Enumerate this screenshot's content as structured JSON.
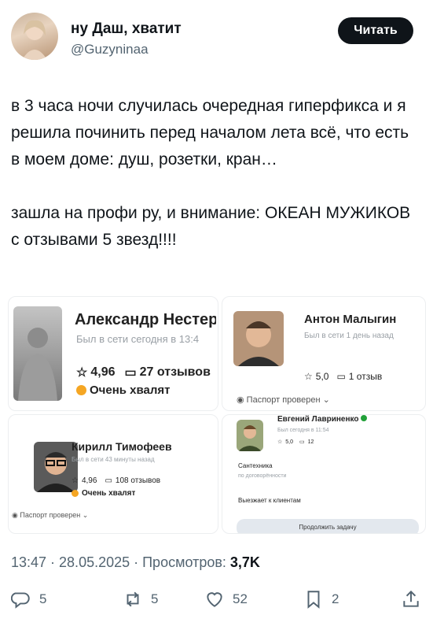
{
  "tweet": {
    "display_name": "ну Даш, хватит",
    "handle": "@Guzyninaa",
    "follow_label": "Читать",
    "text": "в 3 часа ночи случилась очередная гиперфикса и я решила починить перед началом лета всё, что есть в моем доме: душ, розетки, кран…\n\nзашла на профи ру, и внимание: ОКЕАН МУЖИКОВ с отзывами 5 звезд!!!!"
  },
  "collage": {
    "card1": {
      "name": "Александр Нестеров",
      "status": "Был в сети сегодня в 13:4",
      "rating": "4,96",
      "reviews": "27 отзывов",
      "badge": "Очень хвалят"
    },
    "card2": {
      "name": "Антон Малыгин",
      "status": "Был в сети 1 день назад",
      "rating": "5,0",
      "reviews": "1 отзыв",
      "passport": "Паспорт проверен ⌄"
    },
    "card3": {
      "name": "Кирилл Тимофеев",
      "status": "Был в сети 43 минуты назад",
      "rating": "4,96",
      "reviews": "108 отзывов",
      "badge": "Очень хвалят",
      "passport": "Паспорт проверен ⌄"
    },
    "card4": {
      "name": "Евгений Лавриненко",
      "status": "Был сегодня в 11:54",
      "rating": "5,0",
      "reviews": "12",
      "category": "Сантехника",
      "pricing": "по договорённости",
      "travel": "Выезжает к клиентам",
      "cta": "Продолжить задачу"
    }
  },
  "meta": {
    "time": "13:47 · 28.05.2025 · Просмотров: ",
    "views": "3,7K"
  },
  "actions": {
    "replies": "5",
    "reposts": "5",
    "likes": "52",
    "bookmarks": "2"
  },
  "colors": {
    "accent_orange": "#f5a623",
    "verified_green": "#21a038"
  }
}
